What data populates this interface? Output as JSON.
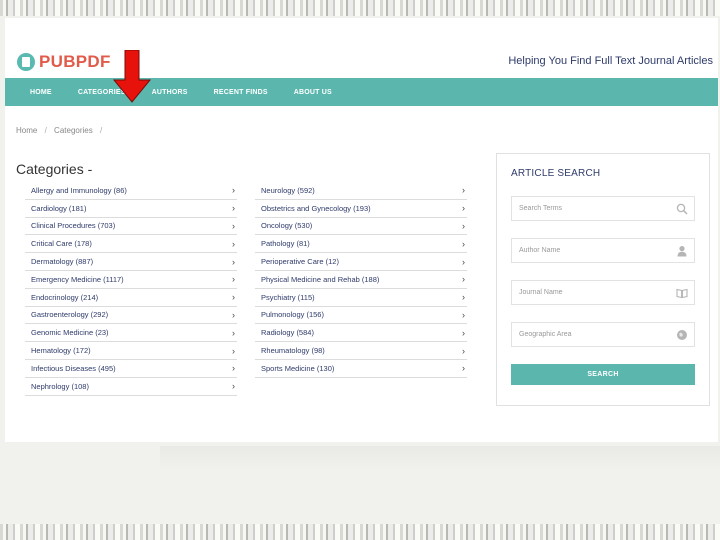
{
  "header": {
    "logo_text": "PUBPDF",
    "tagline": "Helping You Find Full Text Journal Articles"
  },
  "nav": {
    "items": [
      "HOME",
      "CATEGORIES",
      "AUTHORS",
      "RECENT FINDS",
      "ABOUT US"
    ]
  },
  "breadcrumb": {
    "home": "Home",
    "current": "Categories"
  },
  "page_title": "Categories -",
  "categories": {
    "left": [
      "Allergy and Immunology (86)",
      "Cardiology (181)",
      "Clinical Procedures (703)",
      "Critical Care (178)",
      "Dermatology (887)",
      "Emergency Medicine (1117)",
      "Endocrinology (214)",
      "Gastroenterology (292)",
      "Genomic Medicine (23)",
      "Hematology (172)",
      "Infectious Diseases (495)",
      "Nephrology (108)"
    ],
    "right": [
      "Neurology (592)",
      "Obstetrics and Gynecology (193)",
      "Oncology (530)",
      "Pathology (81)",
      "Perioperative Care (12)",
      "Physical Medicine and Rehab (188)",
      "Psychiatry (115)",
      "Pulmonology (156)",
      "Radiology (584)",
      "Rheumatology (98)",
      "Sports Medicine (130)"
    ]
  },
  "search_panel": {
    "title": "ARTICLE SEARCH",
    "fields": [
      {
        "placeholder": "Search Terms",
        "icon": "search-icon"
      },
      {
        "placeholder": "Author Name",
        "icon": "user-icon"
      },
      {
        "placeholder": "Journal Name",
        "icon": "book-icon"
      },
      {
        "placeholder": "Geographic Area",
        "icon": "globe-icon"
      }
    ],
    "button_label": "SEARCH"
  },
  "colors": {
    "teal": "#5bb7ad",
    "logo_red": "#e15b4b",
    "navy_text": "#2f3b6b",
    "arrow_red": "#e8120c"
  }
}
